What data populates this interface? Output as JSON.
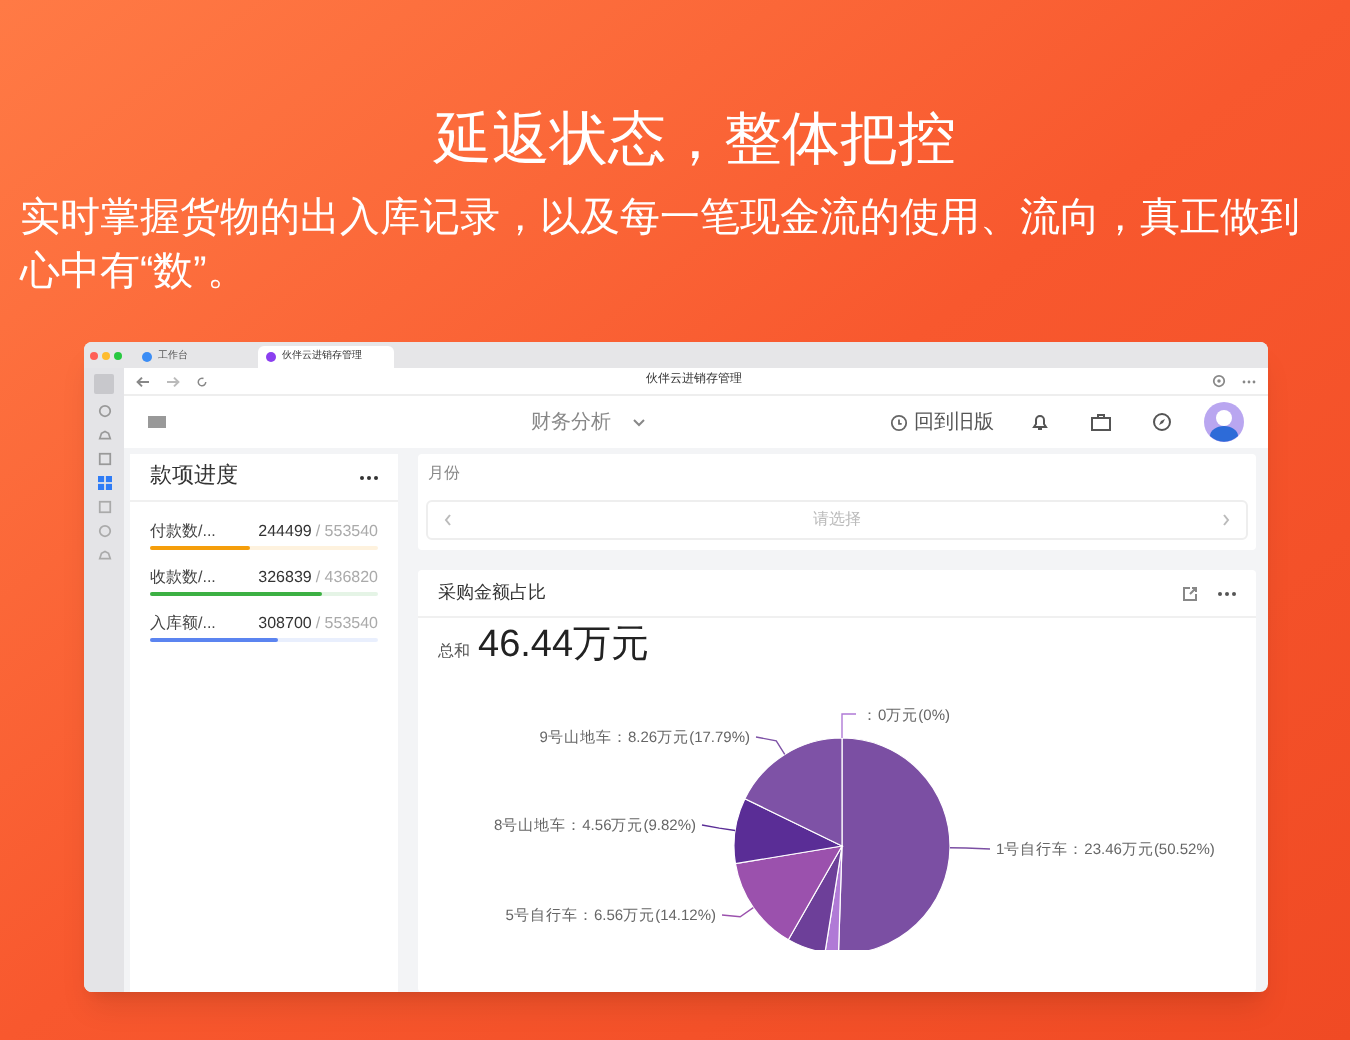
{
  "headline": "延返状态，整体把控",
  "subtitle": "实时掌握货物的出入库记录，以及每一笔现金流的使用、流向，真正做到心中有“数”。",
  "browser": {
    "tabs": [
      {
        "label": "工作台",
        "selected": false
      },
      {
        "label": "伙伴云进销存管理",
        "selected": true
      }
    ],
    "page_title": "伙伴云进销存管理"
  },
  "app_header": {
    "title": "财务分析",
    "back_link": "回到旧版"
  },
  "progress_card": {
    "title": "款项进度",
    "items": [
      {
        "label": "付款数/...",
        "value": "244499",
        "total": "/ 553540",
        "level": 0.44,
        "color": "#f59e0b"
      },
      {
        "label": "收款数/...",
        "value": "326839",
        "total": "/ 436820",
        "level": 0.75,
        "color": "#3cb043"
      },
      {
        "label": "入库额/...",
        "value": "308700",
        "total": "/ 553540",
        "level": 0.56,
        "color": "#5b84f0"
      }
    ]
  },
  "filter": {
    "label": "月份",
    "placeholder": "请选择"
  },
  "chart_card": {
    "title": "采购金额占比",
    "total_label": "总和",
    "total_value": "46.44万元",
    "chart_data": {
      "type": "pie",
      "categories": [
        "1号自行车：23.46万元(50.52%)",
        null,
        null,
        "5号自行车：6.56万元(14.12%)",
        "8号山地车：4.56万元(9.82%)",
        "9号山地车：8.26万元(17.79%)",
        "：0万元(0%)"
      ],
      "values": [
        50.52,
        2.0,
        5.75,
        14.12,
        9.82,
        17.79,
        0
      ],
      "colors": [
        "#7b4fa3",
        "#b07ad6",
        "#6d3f99",
        "#9b51ad",
        "#5a2d96",
        "#7e52a6",
        "#b07ad6"
      ]
    }
  }
}
